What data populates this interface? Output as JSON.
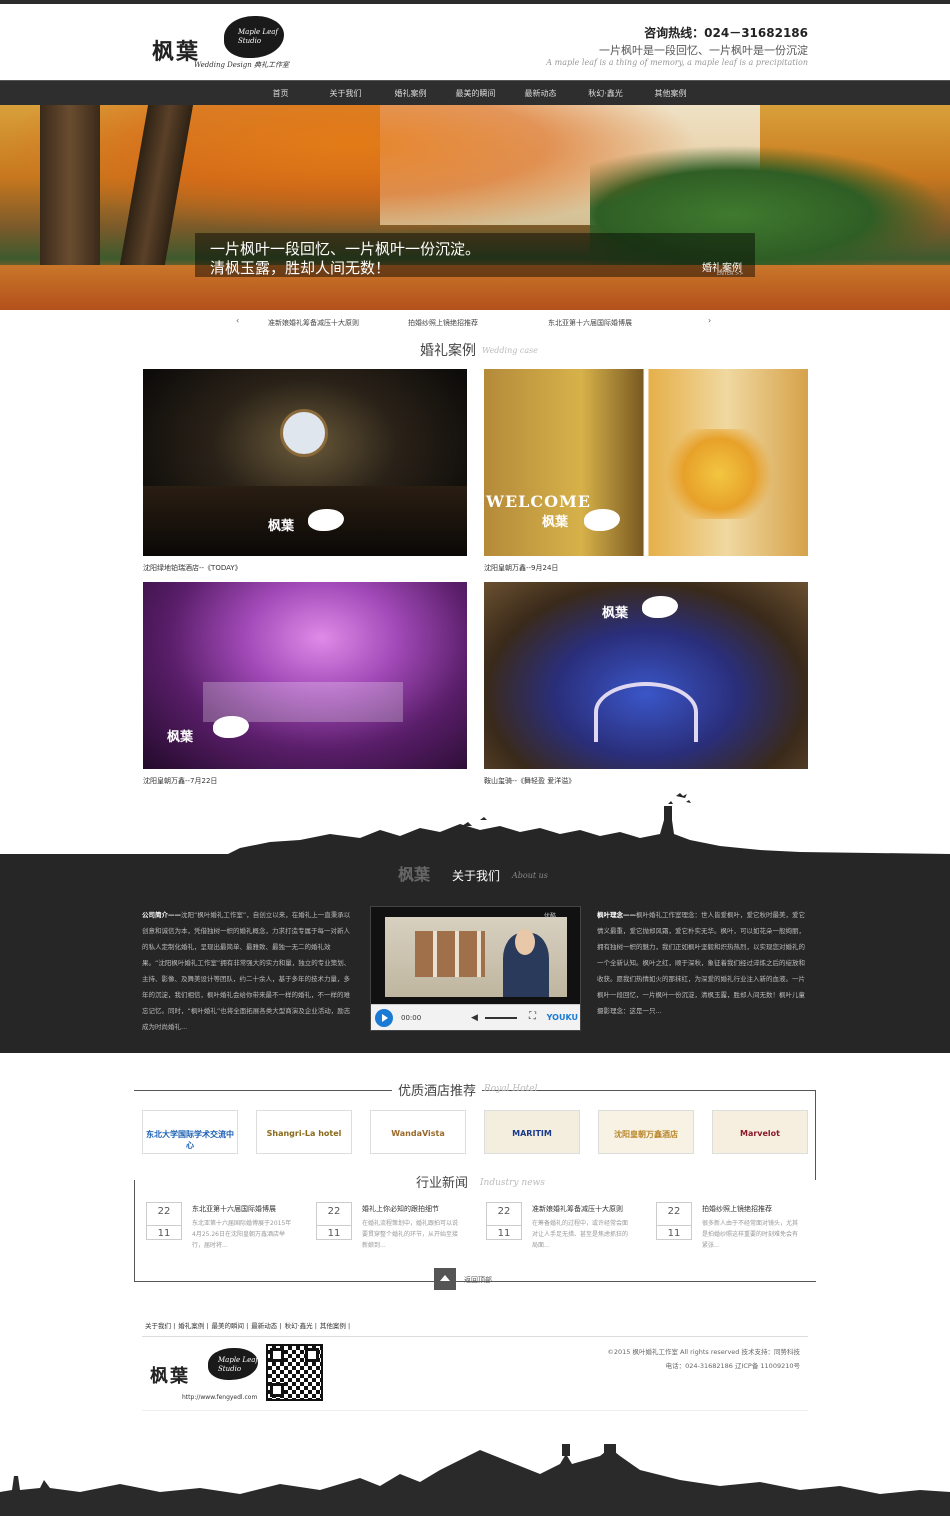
{
  "header": {
    "logo_cn": "枫葉",
    "logo_leaf": "Maple Leaf Studio",
    "logo_en": "Wedding Design 典礼工作室",
    "hotline": "咨询热线：024－31682186",
    "slogan": "一片枫叶是一段回忆、一片枫叶是一份沉淀",
    "slogan_en": "A maple leaf is a thing of memory, a maple leaf is a precipitation"
  },
  "nav": {
    "items": [
      "首页",
      "关于我们",
      "婚礼案例",
      "最美的瞬间",
      "最新动态",
      "秋幻·鑫光",
      "其他案例"
    ]
  },
  "banner": {
    "line1": "一片枫叶一段回忆、一片枫叶一份沉淀。",
    "line2": "清枫玉露，胜却人间无数！",
    "tag": "婚礼案例",
    "tag_sub": "ENTER >>"
  },
  "ticker": {
    "prev": "‹",
    "next": "›",
    "items": [
      "准新娘婚礼筹备减压十大原则",
      "拍婚纱照上镜绝招推荐",
      "东北亚第十六届国际婚博展"
    ]
  },
  "cases": {
    "title": "婚礼案例",
    "subtitle": "Wedding case",
    "items": [
      {
        "caption": "沈阳绿地铂瑞酒店--《TODAY》"
      },
      {
        "caption": "沈阳皇朝万鑫--9月24日"
      },
      {
        "caption": "沈阳皇朝万鑫--7月22日"
      },
      {
        "caption": "鞍山玺骑--《舞轻盈 爱洋溢》"
      }
    ],
    "watermark": "枫葉",
    "welcome": "WELCOME"
  },
  "about": {
    "logo": "枫葉",
    "title": "关于我们",
    "subtitle": "About us",
    "intro_label": "公司简介——",
    "intro_text": "沈阳“枫叶婚礼工作室”，自创立以来，在婚礼上一直秉承以创意和诚信为本，凭借独树一帜的婚礼概念，力求打造专属于每一对新人的私人定制化婚礼，呈现出最简单、最雅致、最独一无二的婚礼效果。“沈阳枫叶婚礼工作室”拥有非常强大的实力和量，独立的专业策划、主持、影像、及舞美设计等团队，约二十余人，基于多年的技术力量，多年的沉淀，我们相信，枫叶婚礼会给你带来最不一样的婚礼，不一样的难忘记忆。同时，“枫叶婚礼”也将全面拓展各类大型商演及企业活动，励志成为时尚婚礼...",
    "concept_label": "枫叶理念——",
    "concept_text": "枫叶婚礼工作室理念：世人皆爱枫叶，爱它秋时最美，爱它情义最重，爱它抛却风霜，爱它朴实无华。枫叶，可以如花朵一般绚丽，拥有独树一帜的魅力，我们正如枫叶坚毅和炽热热烈，以实现您对婚礼的一个全新认知。枫叶之红，顺于深秋，象征着我们经过淬炼之后的绽放和收获。愿我们热情如火的那抹红，为深爱的婚礼行业注入新的血液。一片枫叶一段回忆，一片枫叶一份沉淀，清枫玉露，胜却人间无数！枫叶儿童摄影理念：这是一只...",
    "video_label": "优酷",
    "video_time": "00:00",
    "video_brand": "YOUKU"
  },
  "hotels": {
    "title": "优质酒店推荐",
    "subtitle": "Royal Hotel",
    "items": [
      {
        "name": "东北大学国际学术交流中心",
        "color": "#1a5fb4"
      },
      {
        "name": "Shangri-La hotel",
        "color": "#8a6a1a"
      },
      {
        "name": "WandaVista",
        "color": "#9a6a2a"
      },
      {
        "name": "MARITIM",
        "color": "#1a3a8a"
      },
      {
        "name": "沈阳皇朝万鑫酒店",
        "color": "#b8862a"
      },
      {
        "name": "Marvelot",
        "color": "#8a1a2a"
      }
    ]
  },
  "news": {
    "title": "行业新闻",
    "subtitle": "Industry news",
    "items": [
      {
        "day": "22",
        "month": "11",
        "title": "东北亚第十六届国际婚博展",
        "summary": "东北亚第十六届国际婚博展于2015年4月25.26日在沈阳皇朝万鑫酒店举行，届时将..."
      },
      {
        "day": "22",
        "month": "11",
        "title": "婚礼上你必知的跟拍细节",
        "summary": "在婚礼流程策划中，婚礼跟拍可以说要贯穿整个婚礼的环节，从开始至接新娘到..."
      },
      {
        "day": "22",
        "month": "11",
        "title": "准新娘婚礼筹备减压十大原则",
        "summary": "在筹备婚礼的过程中，或许经常会面对让人手足无措、甚至是焦虑抓狂的局面..."
      },
      {
        "day": "22",
        "month": "11",
        "title": "拍婚纱照上镜绝招推荐",
        "summary": "很多新人由于不经常面对镜头，尤其是拍婚纱照这样重要的时刻难免会有紧张..."
      }
    ]
  },
  "backtop": "返回顶部",
  "footer": {
    "links": [
      "关于我们 |",
      "婚礼案例 |",
      "最美的瞬间 |",
      "最新动态 |",
      "秋幻·鑫光 |",
      "其他案例 |"
    ],
    "url": "http://www.fengyedl.com",
    "copyright": "©2015 枫叶婚礼工作室 All rights reserved 技术支持：同势科技",
    "contact": "电话：024-31682186 辽ICP备 11009210号"
  }
}
